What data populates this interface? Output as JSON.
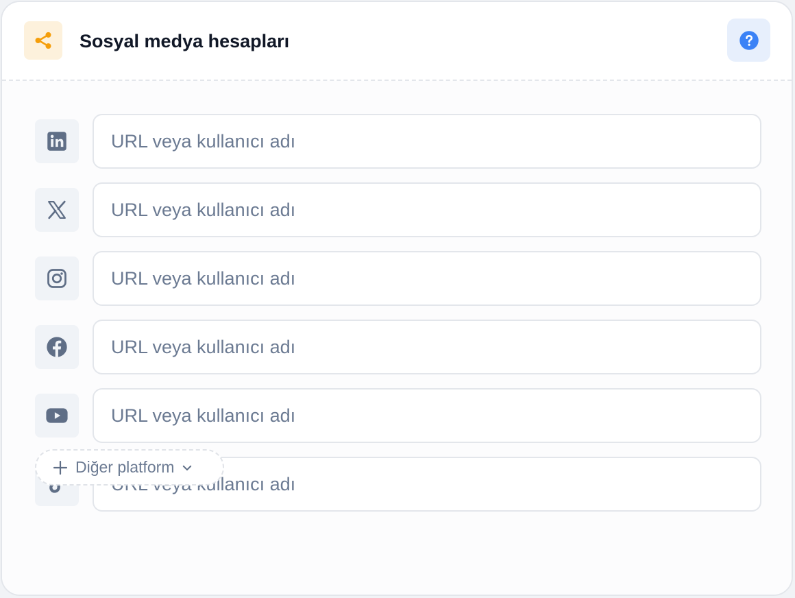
{
  "header": {
    "title": "Sosyal medya hesapları",
    "icon": "share-icon",
    "help_icon": "help-circle-icon"
  },
  "platforms": [
    {
      "icon": "linkedin-icon",
      "placeholder": "URL veya kullanıcı adı",
      "value": ""
    },
    {
      "icon": "x-twitter-icon",
      "placeholder": "URL veya kullanıcı adı",
      "value": ""
    },
    {
      "icon": "instagram-icon",
      "placeholder": "URL veya kullanıcı adı",
      "value": ""
    },
    {
      "icon": "facebook-icon",
      "placeholder": "URL veya kullanıcı adı",
      "value": ""
    },
    {
      "icon": "youtube-icon",
      "placeholder": "URL veya kullanıcı adı",
      "value": ""
    },
    {
      "icon": "tiktok-icon",
      "placeholder": "URL veya kullanıcı adı",
      "value": ""
    }
  ],
  "more_platforms": {
    "label": "Diğer platform",
    "leading_icon": "plus-icon",
    "trailing_icon": "chevron-down-icon"
  },
  "colors": {
    "accent_orange": "#f59e0b",
    "accent_orange_bg": "#fdf1dc",
    "help_blue": "#3b82f6",
    "help_bg": "#e7effc",
    "icon_slate": "#5f6e86",
    "title_text": "#111827",
    "placeholder_text": "#6b7a92",
    "border": "#e3e6eb"
  }
}
